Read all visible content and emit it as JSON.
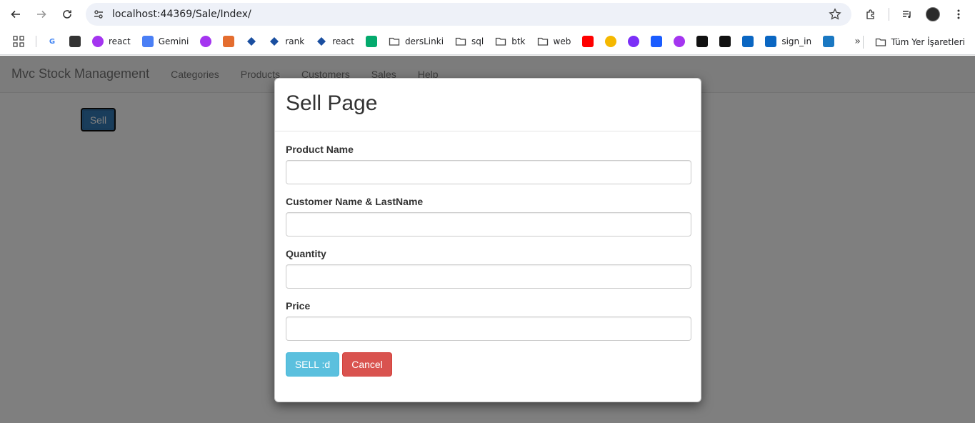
{
  "browser": {
    "url": "localhost:44369/Sale/Index/",
    "bookmarks": [
      {
        "label": "",
        "icon": "google-icon",
        "color": "#4285f4"
      },
      {
        "label": "",
        "icon": "chatgpt-icon",
        "color": "#333333"
      },
      {
        "label": "react",
        "icon": "udemy-icon",
        "color": "#a435f0"
      },
      {
        "label": "Gemini",
        "icon": "gemini-icon",
        "color": "#4a7ff5"
      },
      {
        "label": "",
        "icon": "bot-icon",
        "color": "#a435f0"
      },
      {
        "label": "",
        "icon": "copilot-icon",
        "color": "#e46d2f"
      },
      {
        "label": "",
        "icon": "diamond-icon",
        "color": "#1a4fa0"
      },
      {
        "label": "rank",
        "icon": "diamond-icon",
        "color": "#1a4fa0"
      },
      {
        "label": "react",
        "icon": "diamond-icon",
        "color": "#1a4fa0"
      },
      {
        "label": "",
        "icon": "w3-icon",
        "color": "#04aa6d"
      },
      {
        "label": "dersLinki",
        "icon": "folder-icon",
        "color": "#444444"
      },
      {
        "label": "sql",
        "icon": "folder-icon",
        "color": "#444444"
      },
      {
        "label": "btk",
        "icon": "folder-icon",
        "color": "#444444"
      },
      {
        "label": "web",
        "icon": "folder-icon",
        "color": "#444444"
      },
      {
        "label": "",
        "icon": "youtube-icon",
        "color": "#ff0000"
      },
      {
        "label": "",
        "icon": "circle-icon",
        "color": "#f5b800"
      },
      {
        "label": "",
        "icon": "planet-icon",
        "color": "#7b2ff7"
      },
      {
        "label": "",
        "icon": "y-icon",
        "color": "#1a5cff"
      },
      {
        "label": "",
        "icon": "udemy-icon",
        "color": "#a435f0"
      },
      {
        "label": "",
        "icon": "github-icon",
        "color": "#111111"
      },
      {
        "label": "",
        "icon": "pattern-icon",
        "color": "#111111"
      },
      {
        "label": "",
        "icon": "linkedin-icon",
        "color": "#0a66c2"
      },
      {
        "label": "sign_in",
        "icon": "linkedin-icon",
        "color": "#0a66c2"
      },
      {
        "label": "",
        "icon": "video-icon",
        "color": "#1a78c2"
      }
    ],
    "all_bookmarks_label": "Tüm Yer İşaretleri"
  },
  "app": {
    "brand": "Mvc Stock Management",
    "nav": [
      "Categories",
      "Products",
      "Customers",
      "Sales",
      "Help"
    ],
    "sell_button": "Sell"
  },
  "modal": {
    "title": "Sell Page",
    "fields": [
      {
        "label": "Product Name",
        "value": ""
      },
      {
        "label": "Customer Name & LastName",
        "value": ""
      },
      {
        "label": "Quantity",
        "value": ""
      },
      {
        "label": "Price",
        "value": ""
      }
    ],
    "submit_label": "SELL :d",
    "cancel_label": "Cancel"
  }
}
